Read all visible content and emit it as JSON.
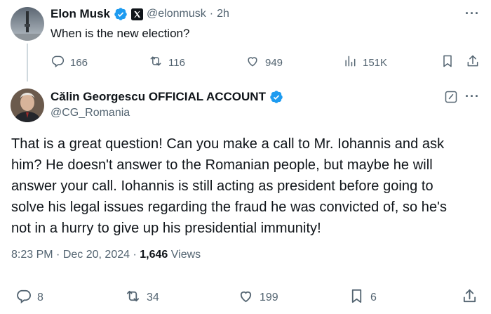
{
  "tweet1": {
    "author_name": "Elon Musk",
    "handle": "@elonmusk",
    "separator": "·",
    "time": "2h",
    "text": "When is the new election?",
    "stats": {
      "replies": "166",
      "reposts": "116",
      "likes": "949",
      "views": "151K"
    }
  },
  "tweet2": {
    "author_name": "Călin Georgescu OFFICIAL ACCOUNT",
    "handle": "@CG_Romania",
    "text": "That is a great question! Can you make a call to Mr. Iohannis and ask him? He doesn't answer to the Romanian people, but maybe he will answer your call. Iohannis is still acting as president before going to solve his legal issues regarding the fraud he was convicted of, so he's not in a hurry to give up his presidential immunity!",
    "time": "8:23 PM",
    "date": "Dec 20, 2024",
    "views_count": "1,646",
    "views_label": "Views",
    "stats": {
      "replies": "8",
      "reposts": "34",
      "likes": "199",
      "bookmarks": "6"
    }
  },
  "more_menu": "···",
  "colors": {
    "verified_blue": "#1d9bf0",
    "muted": "#536471",
    "text": "#0f1419",
    "thread_line": "#cfd9de"
  },
  "icons": [
    "more-icon",
    "verified-badge-icon",
    "x-logo-icon",
    "reply-icon",
    "repost-icon",
    "like-icon",
    "views-icon",
    "bookmark-icon",
    "share-icon",
    "edit-icon"
  ]
}
